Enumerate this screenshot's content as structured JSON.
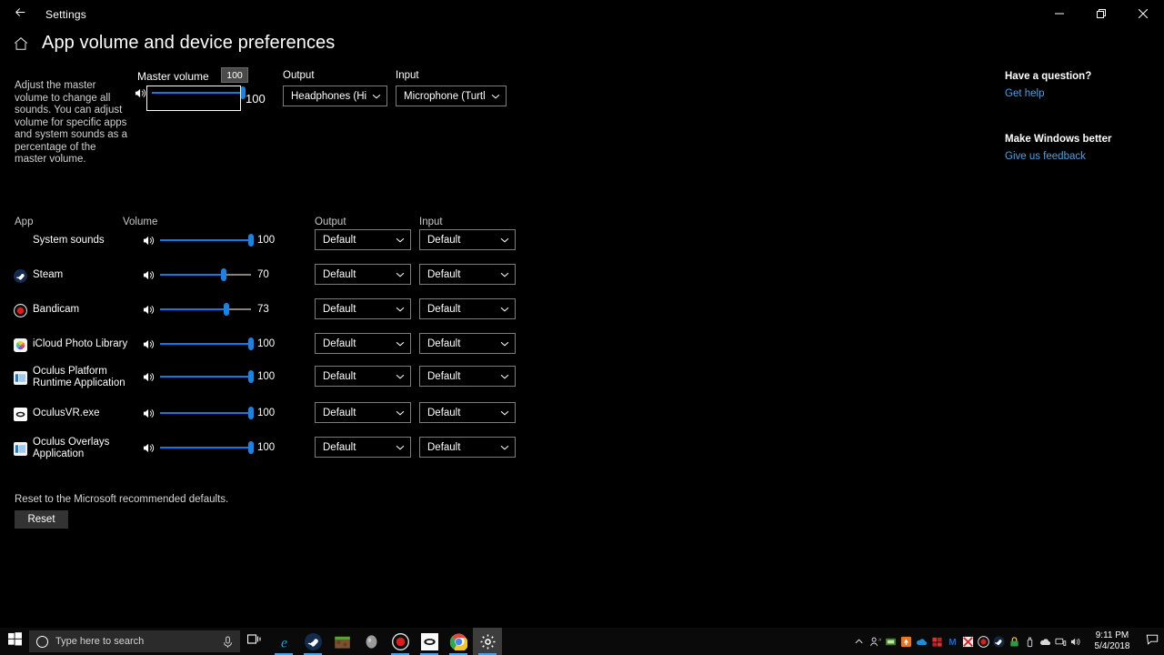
{
  "window": {
    "title": "Settings",
    "back_icon": "back-arrow-icon",
    "minimize_icon": "minimize-icon",
    "maximize_icon": "restore-icon",
    "close_icon": "close-icon"
  },
  "header": {
    "home_icon": "home-icon",
    "title": "App volume and device preferences"
  },
  "description": "Adjust the master volume to change all sounds. You can adjust volume for specific apps and system sounds as a percentage of the master volume.",
  "master": {
    "label": "Master volume",
    "tooltip_value": "100",
    "value": 100,
    "value_text": "100",
    "speaker_icon": "speaker-icon",
    "output": {
      "label": "Output",
      "value": "Headphones (High...",
      "chevron_icon": "chevron-down-icon"
    },
    "input": {
      "label": "Input",
      "value": "Microphone (Turtl...",
      "chevron_icon": "chevron-down-icon"
    }
  },
  "help": {
    "question_heading": "Have a question?",
    "get_help_link": "Get help",
    "feedback_heading": "Make Windows better",
    "feedback_link": "Give us feedback"
  },
  "list": {
    "headers": {
      "app": "App",
      "volume": "Volume",
      "output": "Output",
      "input": "Input"
    },
    "default_option": "Default",
    "rows": [
      {
        "name": "System sounds",
        "icon": "none",
        "volume": 100,
        "volume_text": "100",
        "output": "Default",
        "input": "Default"
      },
      {
        "name": "Steam",
        "icon": "steam-icon",
        "volume": 70,
        "volume_text": "70",
        "output": "Default",
        "input": "Default"
      },
      {
        "name": "Bandicam",
        "icon": "bandicam-icon",
        "volume": 73,
        "volume_text": "73",
        "output": "Default",
        "input": "Default"
      },
      {
        "name": "iCloud Photo Library",
        "icon": "icloud-photos-icon",
        "volume": 100,
        "volume_text": "100",
        "output": "Default",
        "input": "Default"
      },
      {
        "name": "Oculus Platform Runtime Application",
        "icon": "oculus-platform-icon",
        "volume": 100,
        "volume_text": "100",
        "output": "Default",
        "input": "Default"
      },
      {
        "name": "OculusVR.exe",
        "icon": "oculusvr-icon",
        "volume": 100,
        "volume_text": "100",
        "output": "Default",
        "input": "Default"
      },
      {
        "name": "Oculus Overlays Application",
        "icon": "oculus-overlays-icon",
        "volume": 100,
        "volume_text": "100",
        "output": "Default",
        "input": "Default"
      }
    ]
  },
  "reset": {
    "text": "Reset to the Microsoft recommended defaults.",
    "button_label": "Reset"
  },
  "taskbar": {
    "start_icon": "windows-start-icon",
    "search_placeholder": "Type here to search",
    "search_icon": "cortana-circle-icon",
    "mic_icon": "microphone-icon",
    "task_view_icon": "task-view-icon",
    "apps": [
      {
        "icon": "internet-explorer-icon",
        "running": true
      },
      {
        "icon": "steam-icon",
        "running": true
      },
      {
        "icon": "minecraft-icon",
        "running": false
      },
      {
        "icon": "oculus-home-icon",
        "running": false
      },
      {
        "icon": "bandicam-icon",
        "running": true
      },
      {
        "icon": "oculusvr-icon",
        "running": true
      },
      {
        "icon": "chrome-icon",
        "running": true
      },
      {
        "icon": "settings-gear-icon",
        "running": true,
        "active": true
      }
    ],
    "tray": [
      "people-icon",
      "greenshot-icon",
      "orange-tray-icon",
      "onedrive-blue-icon",
      "red-flag-icon",
      "malwarebytes-icon",
      "red-window-icon",
      "bandicam-tray-icon",
      "steam-tray-icon",
      "yellow-lock-icon",
      "usb-icon",
      "onedrive-icon",
      "network-icon",
      "volume-icon"
    ],
    "clock_time": "9:11 PM",
    "clock_date": "5/4/2018",
    "action_center_icon": "action-center-icon"
  },
  "colors": {
    "accent": "#1784e8",
    "link": "#4aa0e6",
    "track": "#8a8178",
    "background": "#000000"
  }
}
